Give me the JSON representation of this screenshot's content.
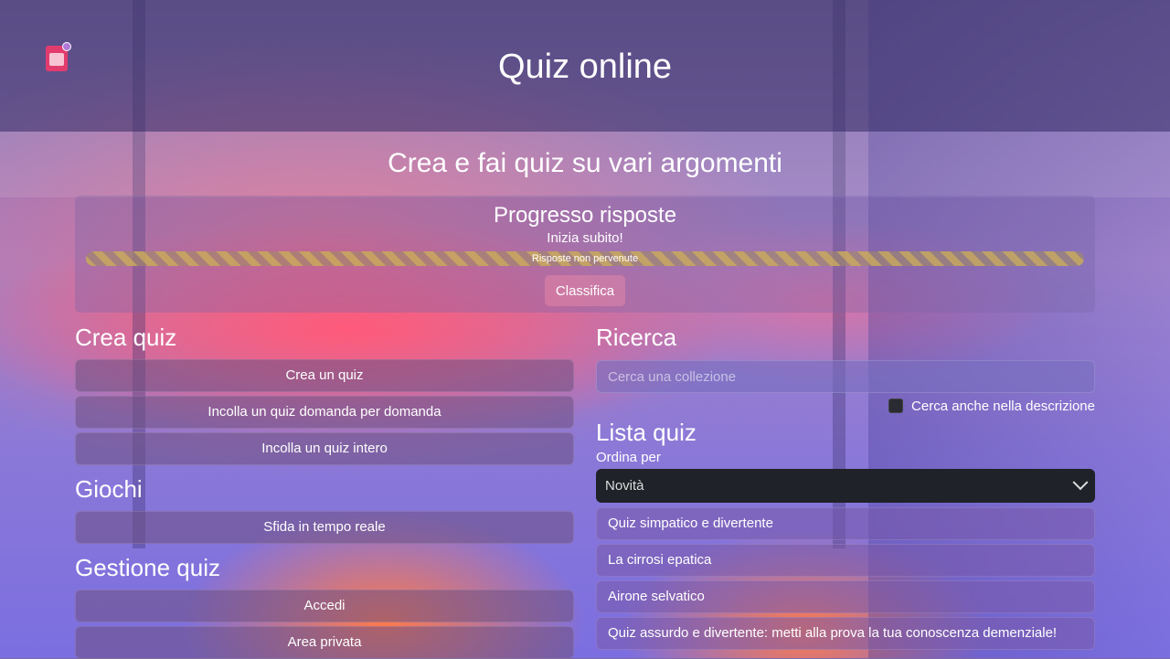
{
  "header": {
    "title": "Quiz online"
  },
  "hero": {
    "subtitle": "Crea e fai quiz su vari argomenti"
  },
  "progress": {
    "title": "Progresso risposte",
    "subtitle": "Inizia subito!",
    "bar_text": "Risposte non pervenute",
    "value": 0,
    "ranking_button": "Classifica"
  },
  "create": {
    "title": "Crea quiz",
    "buttons": [
      "Crea un quiz",
      "Incolla un quiz domanda per domanda",
      "Incolla un quiz intero"
    ]
  },
  "games": {
    "title": "Giochi",
    "buttons": [
      "Sfida in tempo reale"
    ]
  },
  "manage": {
    "title": "Gestione quiz",
    "buttons": [
      "Accedi",
      "Area privata"
    ]
  },
  "search": {
    "title": "Ricerca",
    "placeholder": "Cerca una collezione",
    "checkbox_label": "Cerca anche nella descrizione"
  },
  "list": {
    "title": "Lista quiz",
    "sort_label": "Ordina per",
    "sort_value": "Novità",
    "items": [
      "Quiz simpatico e divertente",
      "La cirrosi epatica",
      "Airone selvatico",
      "Quiz assurdo e divertente: metti alla prova la tua conoscenza demenziale!"
    ]
  }
}
